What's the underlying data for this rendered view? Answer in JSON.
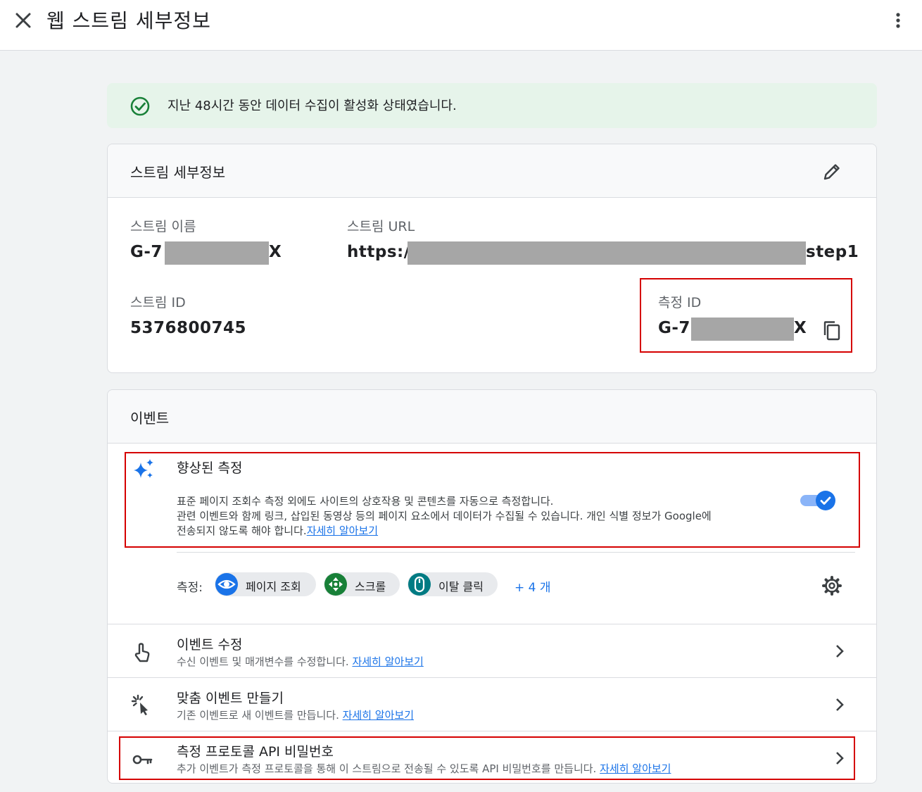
{
  "header": {
    "title": "웹 스트림 세부정보"
  },
  "banner": {
    "message": "지난 48시간 동안 데이터 수집이 활성화 상태였습니다."
  },
  "stream_details": {
    "title": "스트림 세부정보",
    "name_label": "스트림 이름",
    "name_prefix": "G-7",
    "name_suffix": "X",
    "url_label": "스트림 URL",
    "url_prefix": "https://",
    "url_suffix": "step1",
    "id_label": "스트림 ID",
    "id_value": "5376800745",
    "measurement_label": "측정 ID",
    "measurement_prefix": "G-7",
    "measurement_suffix": "X"
  },
  "events": {
    "title": "이벤트",
    "enhanced": {
      "title": "향상된 측정",
      "desc_line1": "표준 페이지 조회수 측정 외에도 사이트의 상호작용 및 콘텐츠를 자동으로 측정합니다.",
      "desc_line2": "관련 이벤트와 함께 링크, 삽입된 동영상 등의 페이지 요소에서 데이터가 수집될 수 있습니다. 개인 식별 정보가 Google에",
      "desc_line3": "전송되지 않도록 해야 합니다.",
      "learn_more": "자세히 알아보기",
      "enabled": true
    },
    "measure_label": "측정:",
    "chips": [
      {
        "label": "페이지 조회",
        "color": "#1a73e8"
      },
      {
        "label": "스크롤",
        "color": "#188038"
      },
      {
        "label": "이탈 클릭",
        "color": "#007b83"
      }
    ],
    "more_label": "+ 4 개",
    "rows": [
      {
        "title": "이벤트 수정",
        "desc": "수신 이벤트 및 매개변수를 수정합니다.",
        "link": "자세히 알아보기"
      },
      {
        "title": "맞춤 이벤트 만들기",
        "desc": "기존 이벤트로 새 이벤트를 만듭니다.",
        "link": "자세히 알아보기"
      },
      {
        "title": "측정 프로토콜 API 비밀번호",
        "desc": "추가 이벤트가 측정 프로토콜을 통해 이 스트림으로 전송될 수 있도록 API 비밀번호를 만듭니다.",
        "link": "자세히 알아보기"
      }
    ]
  },
  "colors": {
    "accent": "#1a73e8",
    "success": "#188038",
    "highlight_border": "#d50000"
  }
}
